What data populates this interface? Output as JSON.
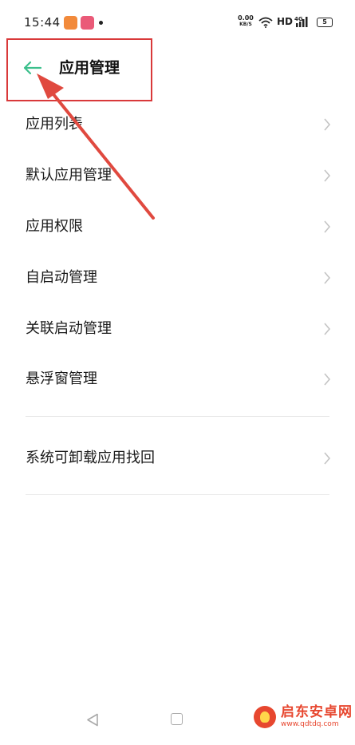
{
  "status_bar": {
    "time": "15:44",
    "net_speed_value": "0.00",
    "net_speed_unit": "KB/S",
    "hd_label": "HD",
    "network_label": "4G",
    "battery_level": "5"
  },
  "header": {
    "title": "应用管理"
  },
  "menu": {
    "items": [
      {
        "label": "应用列表"
      },
      {
        "label": "默认应用管理"
      },
      {
        "label": "应用权限"
      },
      {
        "label": "自启动管理"
      },
      {
        "label": "关联启动管理"
      },
      {
        "label": "悬浮窗管理"
      },
      {
        "label": "系统可卸载应用找回"
      }
    ]
  },
  "watermark": {
    "name": "启东安卓网",
    "url": "www.qdtdq.com"
  },
  "colors": {
    "accent_back": "#3cbf8c",
    "annotation_red": "#d9393a",
    "chevron": "#c4c4c4",
    "divider": "#e8e8e8"
  },
  "icons": {
    "back": "arrow-left-icon",
    "chevron": "chevron-right-icon",
    "nav_back": "triangle-back-icon",
    "nav_home": "square-home-icon"
  }
}
